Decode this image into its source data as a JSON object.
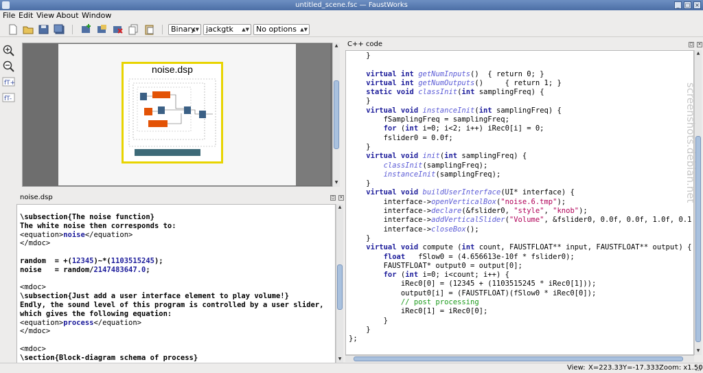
{
  "window": {
    "title": "untitled_scene.fsc — FaustWorks"
  },
  "menu": [
    "File",
    "Edit",
    "View",
    "About",
    "Window"
  ],
  "toolbar": {
    "combo_export": "Binary",
    "combo_arch": "jackgtk",
    "combo_options": "No options"
  },
  "scene": {
    "block_title": "noise.dsp"
  },
  "left_dock": {
    "title": "noise.dsp",
    "lines": [
      "\\subsection{The noise function}",
      "The white noise then corresponds to:",
      "<equation>noise</equation>",
      "</mdoc>",
      "",
      "random  = +(12345)~*(1103515245);",
      "noise   = random/2147483647.0;",
      "",
      "<mdoc>",
      "\\subsection{Just add a user interface element to play volume!}",
      "Endly, the sound level of this program is controlled by a user slider,",
      "which gives the following equation:",
      "<equation>process</equation>",
      "</mdoc>",
      "",
      "<mdoc>",
      "\\section{Block-diagram schema of process}"
    ]
  },
  "right_dock": {
    "title": "C++ code",
    "lines": [
      "    }",
      "",
      "    virtual int getNumInputs()  { return 0; }",
      "    virtual int getNumOutputs()     { return 1; }",
      "    static void classInit(int samplingFreq) {",
      "    }",
      "    virtual void instanceInit(int samplingFreq) {",
      "        fSamplingFreq = samplingFreq;",
      "        for (int i=0; i<2; i++) iRec0[i] = 0;",
      "        fslider0 = 0.0f;",
      "    }",
      "    virtual void init(int samplingFreq) {",
      "        classInit(samplingFreq);",
      "        instanceInit(samplingFreq);",
      "    }",
      "    virtual void buildUserInterface(UI* interface) {",
      "        interface->openVerticalBox(\"noise.6.tmp\");",
      "        interface->declare(&fslider0, \"style\", \"knob\");",
      "        interface->addVerticalSlider(\"Volume\", &fslider0, 0.0f, 0.0f, 1.0f, 0.1",
      "        interface->closeBox();",
      "    }",
      "    virtual void compute (int count, FAUSTFLOAT** input, FAUSTFLOAT** output) {",
      "        float   fSlow0 = (4.656613e-10f * fslider0);",
      "        FAUSTFLOAT* output0 = output[0];",
      "        for (int i=0; i<count; i++) {",
      "            iRec0[0] = (12345 + (1103515245 * iRec0[1]));",
      "            output0[i] = (FAUSTFLOAT)(fSlow0 * iRec0[0]);",
      "            // post processing",
      "            iRec0[1] = iRec0[0];",
      "        }",
      "    }",
      "};"
    ]
  },
  "status": {
    "view_label": "View:",
    "x": "X=223.33",
    "y": "Y=-17.333",
    "zoom": "Zoom: x1.50"
  },
  "watermark": "screenshots.debian.net",
  "colors": {
    "title_bar": "#5a7db5",
    "scene_frame": "#e8d400",
    "keyword": "#1b1b9a",
    "function": "#5b5bd6",
    "string": "#b00058",
    "comment": "#1a9a1a"
  }
}
